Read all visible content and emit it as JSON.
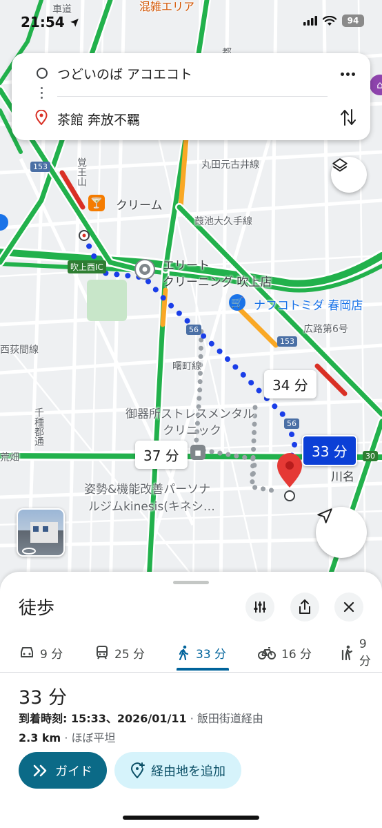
{
  "status_bar": {
    "time": "21:54",
    "battery": "94"
  },
  "route": {
    "origin": "つどいのば アコエコト",
    "destination": "茶館 奔放不羈"
  },
  "map": {
    "labels": {
      "kurumadou": "車道",
      "kondou": "混雑エリア",
      "ato": "都",
      "maruta": "丸田元古井線",
      "kakuoyama": "覚王山",
      "hagaike": "葭池大久手線",
      "cream": "クリーム",
      "fukiage_ic": "吹上西IC",
      "elite": "エリート",
      "elite2": "クリーニング 吹上店",
      "nafuko": "ナフコトミダ 春岡店",
      "hirokoji": "広路第6号",
      "nishiogikubo": "西荻間線",
      "akebono": "曙町線",
      "gokisho": "御器所ストレスメンタル",
      "clinic": "クリニック",
      "chigusa": "千種都通",
      "kawana": "川名",
      "kinesis1": "姿勢&機能改善パーソナ",
      "kinesis2": "ルジムkinesis(キネシ…",
      "arahata": "荒畑",
      "shield_153a": "153",
      "shield_153b": "153",
      "shield_56a": "56",
      "shield_56b": "56",
      "shield_30": "30"
    },
    "durations": {
      "alt1": "34 分",
      "selected": "33 分",
      "alt2": "37 分"
    }
  },
  "sheet": {
    "title": "徒歩",
    "modes": [
      {
        "icon": "car-icon",
        "label": "9 分"
      },
      {
        "icon": "transit-icon",
        "label": "25 分"
      },
      {
        "icon": "walk-icon",
        "label": "33 分"
      },
      {
        "icon": "bike-icon",
        "label": "16 分"
      },
      {
        "icon": "rideshare-icon",
        "label": "9 分"
      }
    ],
    "duration": "33 分",
    "arrival_label": "到着時刻: 15:33、2026/01/11",
    "via": " · 飯田街道経由",
    "distance": "2.3 km",
    "terrain": " · ほぼ平坦",
    "guide_button": "ガイド",
    "add_stop_button": "経由地を追加"
  },
  "colors": {
    "route": "#1a3ee8",
    "traffic_green": "#1db954",
    "accent": "#0b6a87"
  }
}
